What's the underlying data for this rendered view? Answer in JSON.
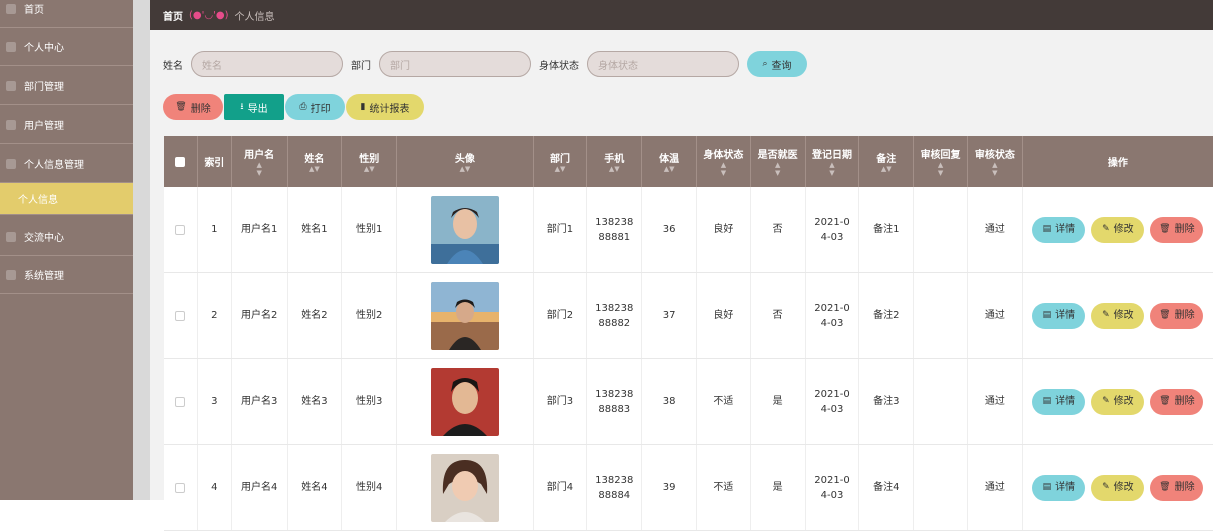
{
  "sidebar": {
    "items": [
      {
        "label": "首页",
        "icon": "home-icon"
      },
      {
        "label": "个人中心",
        "icon": "user-icon"
      },
      {
        "label": "部门管理",
        "icon": "grid-icon"
      },
      {
        "label": "用户管理",
        "icon": "grid-icon"
      },
      {
        "label": "个人信息管理",
        "icon": "grid-icon"
      },
      {
        "label": "个人信息",
        "icon": "none"
      },
      {
        "label": "交流中心",
        "icon": "grid-icon"
      },
      {
        "label": "系统管理",
        "icon": "grid-icon"
      }
    ]
  },
  "topbar": {
    "home": "首页",
    "face": "(●'◡'●)",
    "crumb": "个人信息"
  },
  "search": {
    "name_label": "姓名",
    "name_placeholder": "姓名",
    "dept_label": "部门",
    "dept_placeholder": "部门",
    "status_label": "身体状态",
    "status_placeholder": "身体状态",
    "query_label": "查询"
  },
  "actions": {
    "delete": "删除",
    "export": "导出",
    "print": "打印",
    "stats": "统计报表"
  },
  "table": {
    "headers": [
      "索引",
      "用户名",
      "姓名",
      "性别",
      "头像",
      "部门",
      "手机",
      "体温",
      "身体状态",
      "是否就医",
      "登记日期",
      "备注",
      "审核回复",
      "审核状态",
      "操作"
    ],
    "rows": [
      {
        "index": "1",
        "username": "用户名1",
        "name": "姓名1",
        "gender": "性别1",
        "dept": "部门1",
        "phone": "13823888881",
        "temp": "36",
        "status": "良好",
        "medical": "否",
        "date": "2021-04-03",
        "note": "备注1",
        "reply": "",
        "audit": "通过"
      },
      {
        "index": "2",
        "username": "用户名2",
        "name": "姓名2",
        "gender": "性别2",
        "dept": "部门2",
        "phone": "13823888882",
        "temp": "37",
        "status": "良好",
        "medical": "否",
        "date": "2021-04-03",
        "note": "备注2",
        "reply": "",
        "audit": "通过"
      },
      {
        "index": "3",
        "username": "用户名3",
        "name": "姓名3",
        "gender": "性别3",
        "dept": "部门3",
        "phone": "13823888883",
        "temp": "38",
        "status": "不适",
        "medical": "是",
        "date": "2021-04-03",
        "note": "备注3",
        "reply": "",
        "audit": "通过"
      },
      {
        "index": "4",
        "username": "用户名4",
        "name": "姓名4",
        "gender": "性别4",
        "dept": "部门4",
        "phone": "13823888884",
        "temp": "39",
        "status": "不适",
        "medical": "是",
        "date": "2021-04-03",
        "note": "备注4",
        "reply": "",
        "audit": "通过"
      }
    ],
    "op_labels": {
      "detail": "详情",
      "edit": "修改",
      "delete": "删除"
    }
  }
}
